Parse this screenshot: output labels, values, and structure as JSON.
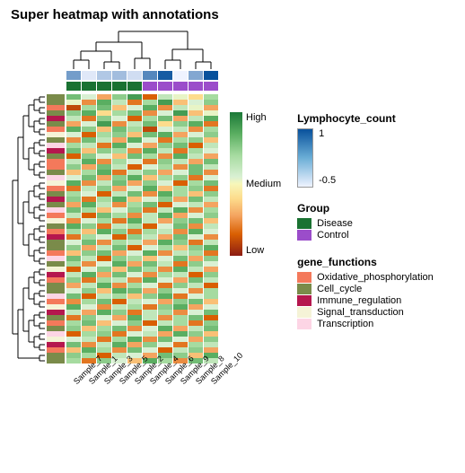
{
  "title": "Super heatmap with annotations",
  "chart_data": {
    "type": "heatmap",
    "title": "Super heatmap with annotations",
    "columns": [
      "Sample_7",
      "Sample_1",
      "Sample_3",
      "Sample_5",
      "Sample_2",
      "Sample_4",
      "Sample_6",
      "Sample_9",
      "Sample_8",
      "Sample_10"
    ],
    "n_rows": 50,
    "value_scale": {
      "levels": [
        "High",
        "Medium",
        "Low"
      ]
    },
    "column_annotations": {
      "Lymphocyte_count": [
        0.3,
        -0.4,
        -0.1,
        0.0,
        -0.3,
        0.5,
        0.9,
        -0.5,
        0.2,
        1.0
      ],
      "Group": [
        "Disease",
        "Disease",
        "Disease",
        "Disease",
        "Disease",
        "Control",
        "Control",
        "Control",
        "Control",
        "Control"
      ]
    },
    "row_annotation": "gene_functions",
    "row_gene_functions": [
      "Cell_cycle",
      "Cell_cycle",
      "Oxidative_phosphorylation",
      "Cell_cycle",
      "Immune_regulation",
      "Cell_cycle",
      "Oxidative_phosphorylation",
      "Signal_transduction",
      "Cell_cycle",
      "Transcription",
      "Immune_regulation",
      "Cell_cycle",
      "Oxidative_phosphorylation",
      "Oxidative_phosphorylation",
      "Cell_cycle",
      "Transcription",
      "Signal_transduction",
      "Oxidative_phosphorylation",
      "Cell_cycle",
      "Immune_regulation",
      "Cell_cycle",
      "Transcription",
      "Oxidative_phosphorylation",
      "Signal_transduction",
      "Cell_cycle",
      "Oxidative_phosphorylation",
      "Immune_regulation",
      "Cell_cycle",
      "Cell_cycle",
      "Oxidative_phosphorylation",
      "Transcription",
      "Cell_cycle",
      "Signal_transduction",
      "Immune_regulation",
      "Oxidative_phosphorylation",
      "Cell_cycle",
      "Cell_cycle",
      "Transcription",
      "Oxidative_phosphorylation",
      "Signal_transduction",
      "Immune_regulation",
      "Cell_cycle",
      "Oxidative_phosphorylation",
      "Cell_cycle",
      "Transcription",
      "Signal_transduction",
      "Immune_regulation",
      "Oxidative_phosphorylation",
      "Cell_cycle",
      "Cell_cycle"
    ],
    "matrix": [
      [
        0.6,
        0.2,
        -0.4,
        0.5,
        0.8,
        -0.7,
        0.3,
        0.1,
        -0.2,
        0.4
      ],
      [
        0.1,
        -0.5,
        0.7,
        0.3,
        -0.6,
        0.4,
        0.8,
        -0.3,
        0.2,
        0.5
      ],
      [
        -0.8,
        0.4,
        0.6,
        -0.3,
        0.2,
        0.7,
        -0.5,
        0.3,
        0.1,
        -0.4
      ],
      [
        0.5,
        0.7,
        -0.2,
        0.4,
        0.6,
        -0.5,
        0.2,
        0.8,
        -0.3,
        0.1
      ],
      [
        0.3,
        -0.6,
        0.5,
        0.2,
        -0.7,
        0.4,
        0.6,
        -0.4,
        0.3,
        0.7
      ],
      [
        -0.4,
        0.2,
        0.8,
        -0.5,
        0.3,
        0.6,
        -0.2,
        0.5,
        0.7,
        -0.6
      ],
      [
        0.7,
        0.5,
        -0.3,
        0.6,
        0.4,
        -0.8,
        0.2,
        0.3,
        -0.5,
        0.4
      ],
      [
        0.2,
        -0.7,
        0.4,
        0.5,
        -0.3,
        0.6,
        0.7,
        -0.4,
        0.2,
        0.5
      ],
      [
        -0.5,
        0.6,
        0.3,
        -0.4,
        0.7,
        0.2,
        -0.6,
        0.4,
        0.5,
        -0.3
      ],
      [
        0.4,
        0.3,
        -0.6,
        0.7,
        0.2,
        -0.4,
        0.5,
        0.6,
        -0.7,
        0.3
      ],
      [
        0.6,
        -0.3,
        0.5,
        0.4,
        -0.5,
        0.7,
        0.3,
        -0.6,
        0.4,
        0.2
      ],
      [
        -0.7,
        0.5,
        0.2,
        -0.3,
        0.6,
        0.4,
        -0.5,
        0.7,
        0.3,
        -0.4
      ],
      [
        0.3,
        0.7,
        -0.5,
        0.4,
        0.2,
        -0.6,
        0.5,
        0.3,
        -0.4,
        0.6
      ],
      [
        0.5,
        -0.4,
        0.6,
        0.3,
        -0.7,
        0.2,
        0.4,
        -0.5,
        0.6,
        0.3
      ],
      [
        -0.3,
        0.4,
        0.7,
        -0.6,
        0.3,
        0.5,
        -0.4,
        0.2,
        0.6,
        -0.5
      ],
      [
        0.2,
        0.6,
        -0.4,
        0.5,
        0.7,
        -0.3,
        0.4,
        0.5,
        -0.6,
        0.2
      ],
      [
        0.7,
        -0.5,
        0.3,
        0.6,
        -0.4,
        0.5,
        0.2,
        -0.7,
        0.4,
        0.6
      ],
      [
        -0.6,
        0.3,
        0.5,
        -0.4,
        0.2,
        0.7,
        -0.3,
        0.4,
        0.5,
        -0.6
      ],
      [
        0.4,
        0.2,
        -0.7,
        0.3,
        0.6,
        -0.5,
        0.7,
        0.4,
        -0.3,
        0.5
      ],
      [
        0.5,
        -0.6,
        0.4,
        0.7,
        -0.3,
        0.2,
        0.5,
        -0.4,
        0.6,
        0.3
      ],
      [
        -0.4,
        0.7,
        0.3,
        -0.5,
        0.4,
        0.6,
        -0.7,
        0.2,
        0.3,
        -0.4
      ],
      [
        0.6,
        0.4,
        -0.3,
        0.2,
        0.5,
        -0.6,
        0.3,
        0.7,
        -0.5,
        0.4
      ],
      [
        0.3,
        -0.7,
        0.6,
        0.4,
        -0.5,
        0.3,
        0.7,
        -0.4,
        0.2,
        0.5
      ],
      [
        -0.5,
        0.2,
        0.4,
        -0.6,
        0.7,
        0.3,
        -0.4,
        0.5,
        0.6,
        -0.3
      ],
      [
        0.7,
        0.5,
        -0.6,
        0.3,
        0.4,
        -0.7,
        0.2,
        0.6,
        -0.5,
        0.3
      ],
      [
        0.4,
        -0.3,
        0.7,
        0.5,
        -0.6,
        0.4,
        0.3,
        -0.5,
        0.7,
        0.2
      ],
      [
        -0.6,
        0.4,
        0.2,
        -0.7,
        0.5,
        0.3,
        -0.4,
        0.6,
        0.2,
        -0.5
      ],
      [
        0.2,
        0.6,
        -0.5,
        0.4,
        0.3,
        -0.4,
        0.7,
        0.5,
        -0.6,
        0.3
      ],
      [
        0.5,
        -0.4,
        0.3,
        0.6,
        -0.7,
        0.2,
        0.4,
        -0.3,
        0.5,
        0.7
      ],
      [
        -0.3,
        0.5,
        0.6,
        -0.4,
        0.2,
        0.7,
        -0.5,
        0.3,
        0.4,
        -0.6
      ],
      [
        0.6,
        0.3,
        -0.7,
        0.5,
        0.4,
        -0.3,
        0.2,
        0.6,
        -0.4,
        0.5
      ],
      [
        0.4,
        -0.5,
        0.2,
        0.7,
        -0.4,
        0.6,
        0.3,
        -0.6,
        0.5,
        0.2
      ],
      [
        -0.7,
        0.2,
        0.5,
        -0.3,
        0.6,
        0.4,
        -0.5,
        0.7,
        0.3,
        -0.4
      ],
      [
        0.3,
        0.7,
        -0.4,
        0.6,
        0.2,
        -0.5,
        0.4,
        0.3,
        -0.7,
        0.5
      ],
      [
        0.5,
        -0.6,
        0.4,
        0.3,
        -0.5,
        0.7,
        0.2,
        -0.4,
        0.6,
        0.3
      ],
      [
        -0.4,
        0.3,
        0.7,
        -0.5,
        0.4,
        0.2,
        -0.6,
        0.5,
        0.3,
        -0.7
      ],
      [
        0.2,
        0.5,
        -0.3,
        0.7,
        0.6,
        -0.4,
        0.5,
        0.2,
        -0.5,
        0.4
      ],
      [
        0.6,
        -0.7,
        0.3,
        0.4,
        -0.3,
        0.5,
        0.7,
        -0.6,
        0.2,
        0.4
      ],
      [
        -0.5,
        0.4,
        0.6,
        -0.7,
        0.3,
        0.2,
        -0.4,
        0.5,
        0.6,
        -0.3
      ],
      [
        0.7,
        0.2,
        -0.5,
        0.3,
        0.4,
        -0.6,
        0.5,
        0.7,
        -0.4,
        0.2
      ],
      [
        0.3,
        -0.4,
        0.7,
        0.5,
        -0.6,
        0.3,
        0.4,
        -0.5,
        0.2,
        0.6
      ],
      [
        -0.6,
        0.5,
        0.2,
        -0.4,
        0.7,
        0.3,
        -0.5,
        0.4,
        0.6,
        -0.7
      ],
      [
        0.4,
        0.6,
        -0.3,
        0.2,
        0.5,
        -0.7,
        0.3,
        0.4,
        -0.6,
        0.5
      ],
      [
        0.5,
        -0.3,
        0.4,
        0.6,
        -0.5,
        0.2,
        0.7,
        -0.4,
        0.3,
        0.6
      ],
      [
        -0.7,
        0.4,
        0.5,
        -0.6,
        0.2,
        0.3,
        -0.4,
        0.7,
        0.5,
        -0.3
      ],
      [
        0.2,
        0.3,
        -0.6,
        0.4,
        0.7,
        -0.5,
        0.6,
        0.2,
        -0.4,
        0.5
      ],
      [
        0.6,
        -0.5,
        0.3,
        0.7,
        -0.4,
        0.5,
        0.2,
        -0.6,
        0.4,
        0.3
      ],
      [
        -0.3,
        0.7,
        0.4,
        -0.5,
        0.6,
        0.2,
        -0.7,
        0.3,
        0.5,
        -0.4
      ],
      [
        0.5,
        0.4,
        -0.7,
        0.3,
        0.2,
        -0.4,
        0.6,
        0.5,
        -0.3,
        0.7
      ],
      [
        0.4,
        -0.6,
        0.5,
        0.2,
        -0.3,
        0.7,
        0.4,
        -0.5,
        0.6,
        0.3
      ]
    ],
    "legends": {
      "Lymphocyte_count": {
        "range": [
          -0.5,
          1
        ],
        "ticks": [
          1,
          -0.5
        ],
        "colorscale": [
          "#08519c",
          "#eff3ff"
        ]
      },
      "Group": {
        "Disease": "#1a7232",
        "Control": "#9b4dca"
      },
      "gene_functions": {
        "Oxidative_phosphorylation": "#f4795b",
        "Cell_cycle": "#7a8b4a",
        "Immune_regulation": "#b5174e",
        "Signal_transduction": "#f5f3d7",
        "Transcription": "#fdd5e5"
      }
    }
  },
  "scale_labels": {
    "high": "High",
    "medium": "Medium",
    "low": "Low"
  },
  "legend_titles": {
    "lymph": "Lymphocyte_count",
    "group": "Group",
    "gene": "gene_functions"
  }
}
